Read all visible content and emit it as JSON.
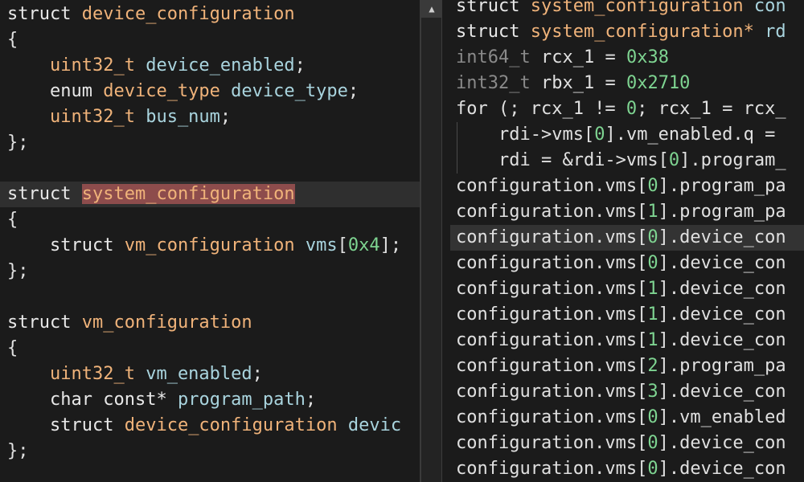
{
  "left_code": {
    "struct_kw": "struct",
    "enum_kw": "enum",
    "char_kw": "char",
    "const_ptr": "const*",
    "lbrace": "{",
    "rbrace": "};",
    "semicolon": ";",
    "device_configuration": "device_configuration",
    "system_configuration": "system_configuration",
    "vm_configuration": "vm_configuration",
    "uint32_t": "uint32_t",
    "device_enabled": "device_enabled",
    "device_type_enum": "device_type",
    "device_type_field": "device_type",
    "bus_num": "bus_num",
    "vms": "vms",
    "vms_open": "[",
    "vms_size": "0x4",
    "vms_close": "]",
    "vm_enabled": "vm_enabled",
    "program_path": "program_path",
    "devic_trunc": "devic"
  },
  "right_code": {
    "line1": {
      "kw": "struct",
      "type": "system_configuration",
      "rest": "con"
    },
    "line2": {
      "kw": "struct",
      "type": "system_configuration*",
      "rest": "rd"
    },
    "line3": {
      "type": "int64_t",
      "var": "rcx_1",
      "eq": "=",
      "value": "0x38"
    },
    "line4": {
      "type": "int32_t",
      "var": "rbx_1",
      "eq": "=",
      "value": "0x2710"
    },
    "line5": {
      "text_a": "for (; rcx_1 != ",
      "zero": "0",
      "text_b": "; rcx_1 = rcx_"
    },
    "line6": {
      "a": "rdi->vms[",
      "idx": "0",
      "b": "].vm_enabled.q ="
    },
    "line7": {
      "a": "rdi = &rdi->vms[",
      "idx": "0",
      "b": "].program_"
    },
    "config_lines": [
      {
        "prefix": "configuration.vms[",
        "idx": "0",
        "suffix": "].program_pa"
      },
      {
        "prefix": "configuration.vms[",
        "idx": "1",
        "suffix": "].program_pa"
      },
      {
        "prefix": "configuration.vms[",
        "idx": "0",
        "suffix": "].device_con"
      },
      {
        "prefix": "configuration.vms[",
        "idx": "0",
        "suffix": "].device_con"
      },
      {
        "prefix": "configuration.vms[",
        "idx": "1",
        "suffix": "].device_con"
      },
      {
        "prefix": "configuration.vms[",
        "idx": "1",
        "suffix": "].device_con"
      },
      {
        "prefix": "configuration.vms[",
        "idx": "1",
        "suffix": "].device_con"
      },
      {
        "prefix": "configuration.vms[",
        "idx": "2",
        "suffix": "].program_pa"
      },
      {
        "prefix": "configuration.vms[",
        "idx": "3",
        "suffix": "].device_con"
      },
      {
        "prefix": "configuration.vms[",
        "idx": "0",
        "suffix": "].vm_enabled"
      },
      {
        "prefix": "configuration.vms[",
        "idx": "0",
        "suffix": "].device_con"
      },
      {
        "prefix": "configuration.vms[",
        "idx": "0",
        "suffix": "].device_con"
      }
    ]
  },
  "scrollbar": {
    "up_arrow_glyph": "▲"
  },
  "colors": {
    "background": "#1b1b1b",
    "type": "#f0b37a",
    "field": "#a9d4de",
    "number": "#7ed491",
    "keyword": "#e8e8e8",
    "selection": "#8d4c4c"
  }
}
